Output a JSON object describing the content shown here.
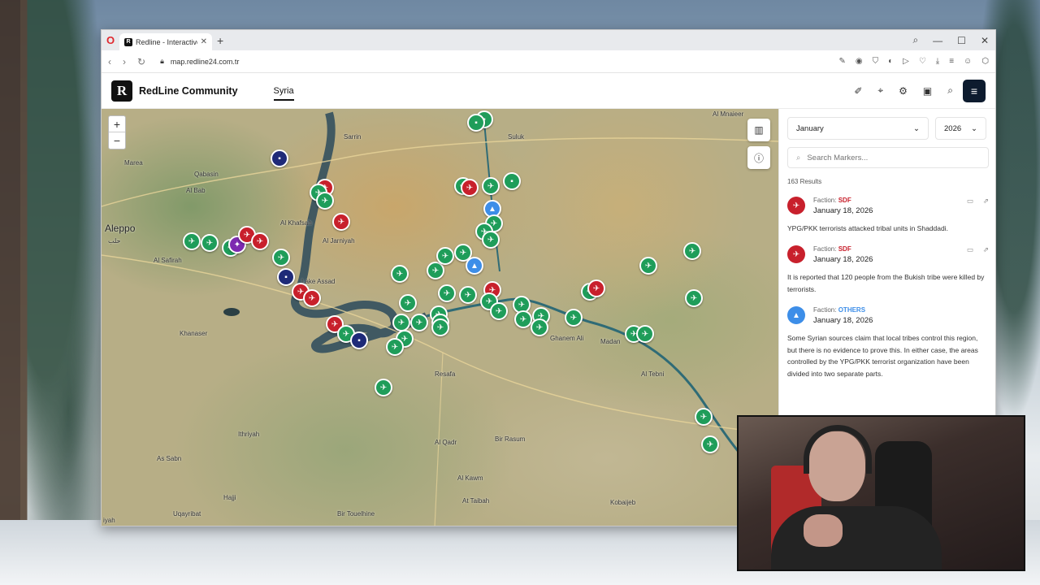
{
  "browser": {
    "tab_title": "Redline - Interactive Strat",
    "url": "map.redline24.com.tr"
  },
  "site": {
    "title": "RedLine Community",
    "nav_active": "Syria"
  },
  "map": {
    "zoom_in": "+",
    "zoom_out": "−",
    "places": {
      "aleppo": "Aleppo",
      "aleppo_ar": "حلب",
      "marea": "Marea",
      "qabasin": "Qabasin",
      "al_bab": "Al Bab",
      "al_khafsah": "Al Khafsah",
      "al_jarniyah": "Al Jarniyah",
      "al_safirah": "Al Safirah",
      "lake_assad": "Lake Assad",
      "khanaser": "Khanaser",
      "ithriyah": "Ithriyah",
      "as_sabn": "As Sabn",
      "resafa": "Resafa",
      "al_qadr": "Al Qadr",
      "bir_rasum": "Bir Rasum",
      "al_kawm": "Al Kawm",
      "at_taibah": "At Taibah",
      "hajji": "Hajji",
      "uqayribat": "Uqayribat",
      "bir_touelhine": "Bir Touelhine",
      "ghanem_ali": "Ghanem Ali",
      "madan": "Madan",
      "al_tebni": "Al Tebni",
      "kobaijeb": "Kobaijeb",
      "suluk": "Suluk",
      "al_mnaieer": "Al Mnaieer",
      "sarrin": "Sarrin",
      "iyah": "iyah"
    }
  },
  "sidebar": {
    "month": "January",
    "year": "2026",
    "search_placeholder": "Search Markers...",
    "results": "163 Results",
    "entries": [
      {
        "faction_label": "Faction:",
        "faction": "SDF",
        "date": "January 18, 2026",
        "text": "YPG/PKK terrorists attacked tribal units in Shaddadi.",
        "color": "#c8202c"
      },
      {
        "faction_label": "Faction:",
        "faction": "SDF",
        "date": "January 18, 2026",
        "text": "It is reported that 120 people from the Bukish tribe were killed by terrorists.",
        "color": "#c8202c"
      },
      {
        "faction_label": "Faction:",
        "faction": "OTHERS",
        "date": "January 18, 2026",
        "text": "Some Syrian sources claim that local tribes control this region, but there is no evidence to prove this. In either case, the areas controlled by the YPG/PKK terrorist organization have been divided into two separate parts.",
        "color": "#3d8ee8"
      }
    ]
  },
  "colors": {
    "sdf_red": "#c8202c",
    "gov_green": "#1f9d5a",
    "others_blue": "#3d8ee8",
    "navy": "#1e2a78",
    "purple": "#7d2ab0"
  }
}
